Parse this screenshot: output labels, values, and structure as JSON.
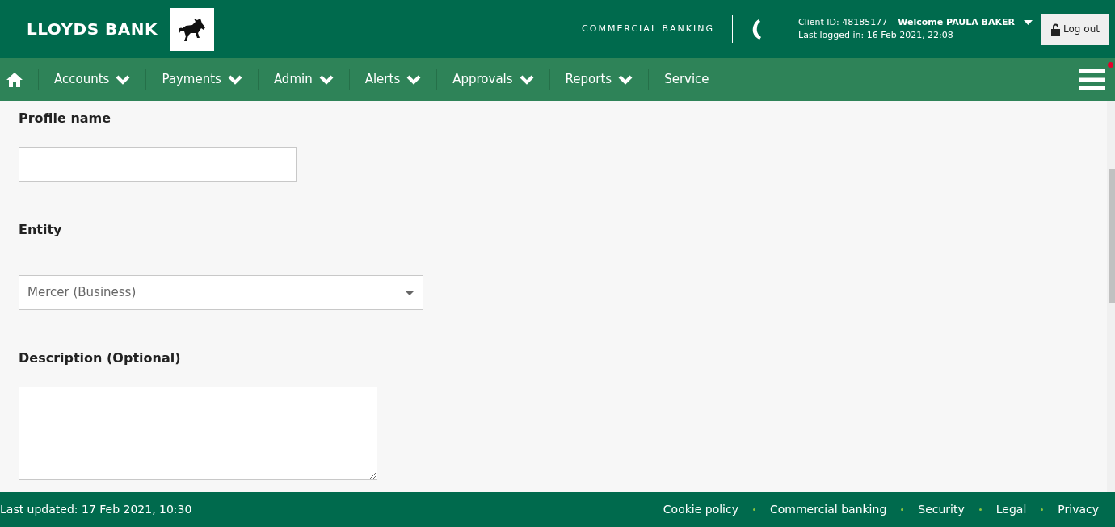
{
  "header": {
    "brand": "LLOYDS BANK",
    "division": "COMMERCIAL BANKING",
    "client_id": "Client ID: 48185177",
    "welcome": "Welcome PAULA BAKER",
    "last_logged_in": "Last logged in: 16 Feb 2021, 22:08",
    "logout": "Log out"
  },
  "nav": {
    "items": [
      {
        "label": "Accounts",
        "kind": "dropdown"
      },
      {
        "label": "Payments",
        "kind": "dropdown"
      },
      {
        "label": "Admin",
        "kind": "dropdown"
      },
      {
        "label": "Alerts",
        "kind": "dropdown"
      },
      {
        "label": "Approvals",
        "kind": "dropdown"
      },
      {
        "label": "Reports",
        "kind": "dropdown"
      },
      {
        "label": "Service",
        "kind": "link"
      }
    ],
    "menu_notification": true
  },
  "form": {
    "fields": [
      {
        "label": "Profile name",
        "kind": "text"
      },
      {
        "label": "Entity",
        "kind": "select",
        "value": "Mercer (Business)"
      },
      {
        "label": "Description (Optional)",
        "kind": "textarea"
      }
    ]
  },
  "footer": {
    "last_updated": "Last updated: 17 Feb 2021, 10:30",
    "links": [
      "Cookie policy",
      "Commercial banking",
      "Security",
      "Legal",
      "Privacy"
    ]
  }
}
